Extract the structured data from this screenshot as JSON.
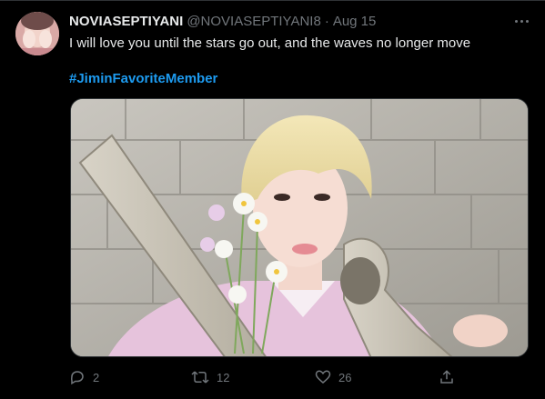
{
  "tweet": {
    "display_name": "NOVIASEPTIYANI",
    "handle": "@NOVIASEPTIYANI8",
    "separator": "·",
    "date": "Aug 15",
    "text": "I will love you until the stars go out, and the waves no longer move",
    "hashtag": "#JiminFavoriteMember"
  },
  "actions": {
    "reply_count": "2",
    "retweet_count": "12",
    "like_count": "26"
  },
  "colors": {
    "background": "#000000",
    "text": "#e7e9ea",
    "secondary": "#71767b",
    "accent": "#1d9bf0"
  },
  "icons": [
    "more-icon",
    "reply-icon",
    "retweet-icon",
    "like-icon",
    "share-icon"
  ]
}
